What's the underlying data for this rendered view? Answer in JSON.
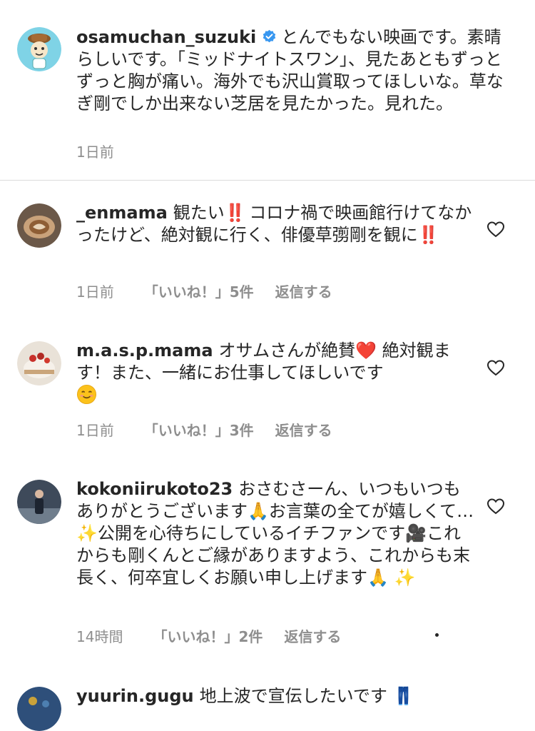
{
  "caption": {
    "username": "osamuchan_suzuki",
    "text": "とんでもない映画です。素晴らしいです。「ミッドナイトスワン」、見たあともずっとずっと胸が痛い。海外でも沢山賞取ってほしいな。草なぎ剛でしか出来ない芝居を見たかった。見れた。",
    "time": "1日前",
    "verified": true
  },
  "comments": [
    {
      "username": "_enmama",
      "text_1": "観たい",
      "emoji_1": "‼️",
      "text_2": "コロナ禍で映画館行けてなかったけど、絶対観に行く、俳優草彅剛を観に",
      "emoji_2": "‼️",
      "time": "1日前",
      "likes": "「いいね！」5件",
      "reply": "返信する"
    },
    {
      "username": "m.a.s.p.mama",
      "text_1": "オサムさんが絶賛",
      "emoji_1": "❤️",
      "text_2": "絶対観ます！また、一緒にお仕事してほしいです",
      "emoji_2": "😊",
      "time": "1日前",
      "likes": "「いいね！」3件",
      "reply": "返信する"
    },
    {
      "username": "kokoniirukoto23",
      "text_1": "おさむさーん、いつもいつもありがとうございます",
      "emoji_1": "🙏",
      "text_2": "お言葉の全てが嬉しくて…",
      "emoji_2": "✨",
      "text_3": "公開を心待ちにしているイチファンです",
      "emoji_3": "🎥",
      "text_4": "これからも剛くんとご縁がありますよう、これからも末長く、何卒宜しくお願い申し上げます",
      "emoji_4": "🙏",
      "emoji_5": "✨",
      "time": "14時間",
      "likes": "「いいね！」2件",
      "reply": "返信する"
    },
    {
      "username": "yuurin.gugu",
      "text_1": "地上波で宣伝したいです",
      "emoji_1": "👖"
    }
  ],
  "icons": {
    "like": "heart-outline-icon",
    "verified": "verified-badge-icon",
    "more": "more-dot-icon"
  },
  "colors": {
    "text": "#262626",
    "meta": "#8e8e8e",
    "verified": "#3897f0",
    "divider": "#dbdbdb",
    "red_mark": "#e02020"
  }
}
